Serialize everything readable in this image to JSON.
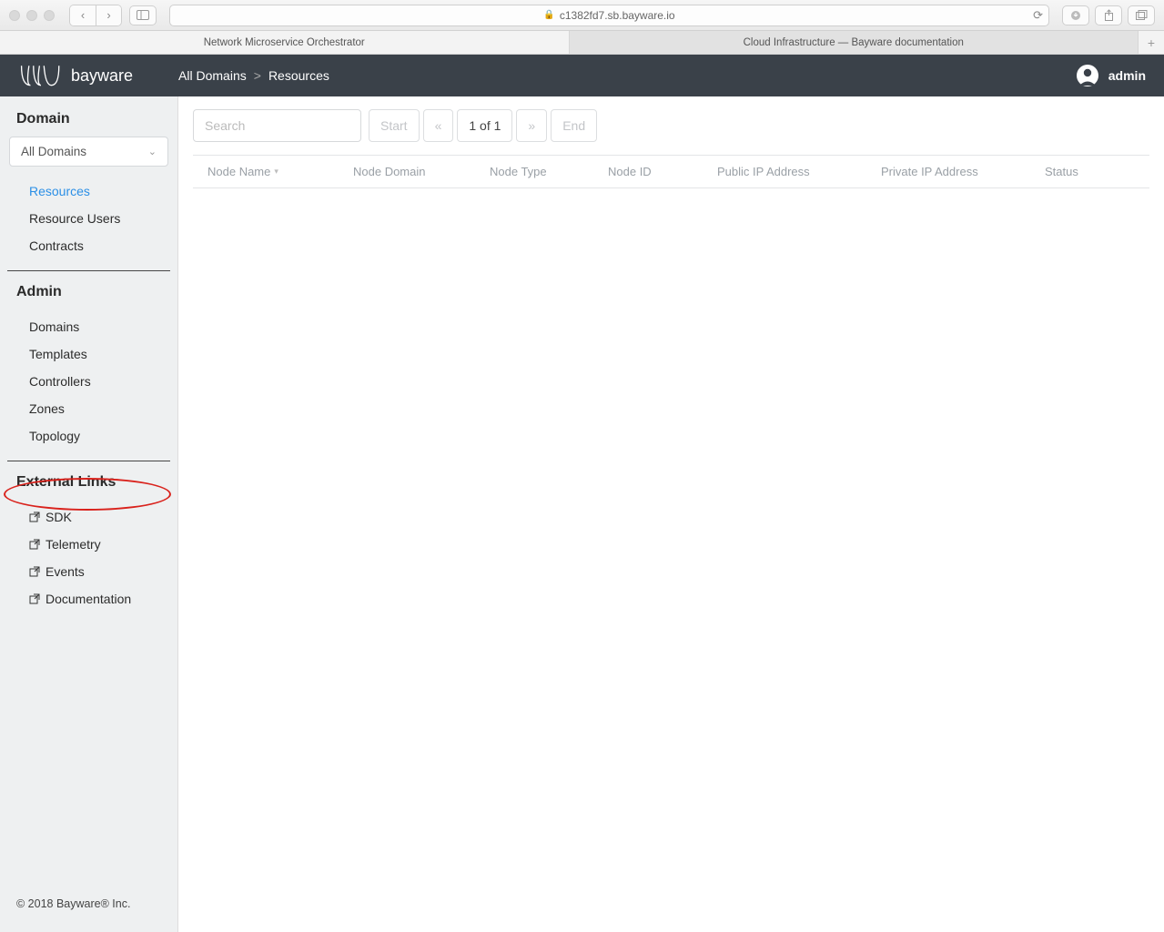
{
  "browser": {
    "url_host": "c1382fd7.sb.bayware.io",
    "tabs": [
      {
        "label": "Network Microservice Orchestrator",
        "active": false
      },
      {
        "label": "Cloud Infrastructure — Bayware documentation",
        "active": true
      }
    ]
  },
  "header": {
    "brand": "bayware",
    "breadcrumbs": [
      "All Domains",
      "Resources"
    ],
    "user": "admin"
  },
  "sidebar": {
    "section_domain_title": "Domain",
    "domain_select_value": "All Domains",
    "domain_items": [
      {
        "label": "Resources",
        "active": true
      },
      {
        "label": "Resource Users",
        "active": false
      },
      {
        "label": "Contracts",
        "active": false
      }
    ],
    "section_admin_title": "Admin",
    "admin_items": [
      {
        "label": "Domains"
      },
      {
        "label": "Templates"
      },
      {
        "label": "Controllers"
      },
      {
        "label": "Zones"
      },
      {
        "label": "Topology"
      }
    ],
    "section_external_title": "External Links",
    "external_items": [
      {
        "label": "SDK"
      },
      {
        "label": "Telemetry"
      },
      {
        "label": "Events"
      },
      {
        "label": "Documentation"
      }
    ],
    "footer": "© 2018 Bayware® Inc."
  },
  "content": {
    "search_placeholder": "Search",
    "pager": {
      "start": "Start",
      "prev": "«",
      "page_indicator": "1 of 1",
      "next": "»",
      "end": "End"
    },
    "columns": [
      "Node Name",
      "Node Domain",
      "Node Type",
      "Node ID",
      "Public IP Address",
      "Private IP Address",
      "Status"
    ]
  },
  "annotation": {
    "highlighted_item": "Telemetry"
  }
}
